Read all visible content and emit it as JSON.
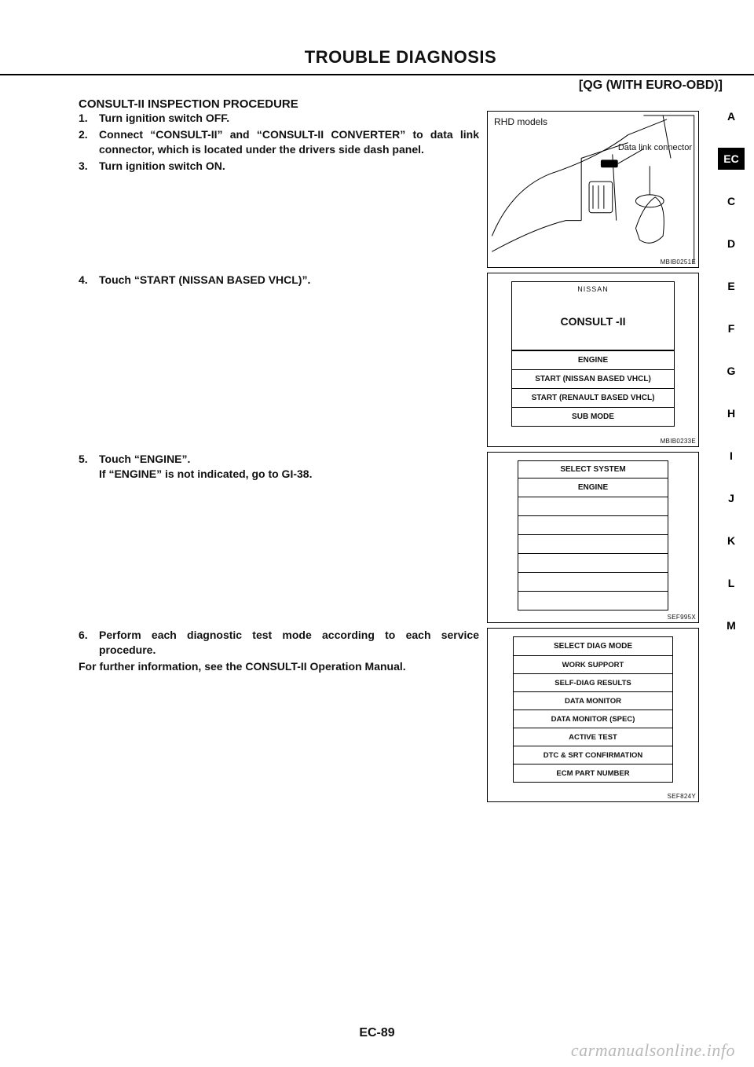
{
  "header": {
    "title": "TROUBLE DIAGNOSIS",
    "subtitle": "[QG (WITH EURO-OBD)]"
  },
  "section_heading": "CONSULT-II INSPECTION PROCEDURE",
  "steps": {
    "s1": {
      "num": "1.",
      "text": "Turn ignition switch OFF."
    },
    "s2": {
      "num": "2.",
      "text": "Connect “CONSULT-II” and “CONSULT-II CONVERTER” to data link connector, which is located under the drivers side dash panel."
    },
    "s3": {
      "num": "3.",
      "text": "Turn ignition switch ON."
    },
    "s4": {
      "num": "4.",
      "text": "Touch “START (NISSAN BASED VHCL)”."
    },
    "s5": {
      "num": "5.",
      "text": "Touch “ENGINE”."
    },
    "s5b": "If “ENGINE” is not indicated, go to GI-38.",
    "s6": {
      "num": "6.",
      "text": "Perform each diagnostic test mode according to each service procedure."
    },
    "note6": "For further information, see the CONSULT-II Operation Manual."
  },
  "fig1": {
    "model": "RHD models",
    "dlc": "Data link connector",
    "code": "MBIB0251E"
  },
  "fig2": {
    "brand": "NISSAN",
    "title": "CONSULT -II",
    "rows": [
      "ENGINE",
      "START (NISSAN BASED VHCL)",
      "START (RENAULT BASED VHCL)",
      "SUB MODE"
    ],
    "code": "MBIB0233E"
  },
  "fig3": {
    "head": "SELECT SYSTEM",
    "rows": [
      "ENGINE",
      "",
      "",
      "",
      "",
      "",
      ""
    ],
    "code": "SEF995X"
  },
  "fig4": {
    "head": "SELECT DIAG MODE",
    "rows": [
      "WORK SUPPORT",
      "SELF-DIAG RESULTS",
      "DATA MONITOR",
      "DATA MONITOR (SPEC)",
      "ACTIVE TEST",
      "DTC & SRT CONFIRMATION",
      "ECM PART NUMBER"
    ],
    "code": "SEF824Y"
  },
  "tabs": [
    "A",
    "EC",
    "C",
    "D",
    "E",
    "F",
    "G",
    "H",
    "I",
    "J",
    "K",
    "L",
    "M"
  ],
  "active_tab": "EC",
  "page_number": "EC-89",
  "watermark": "carmanualsonline.info"
}
